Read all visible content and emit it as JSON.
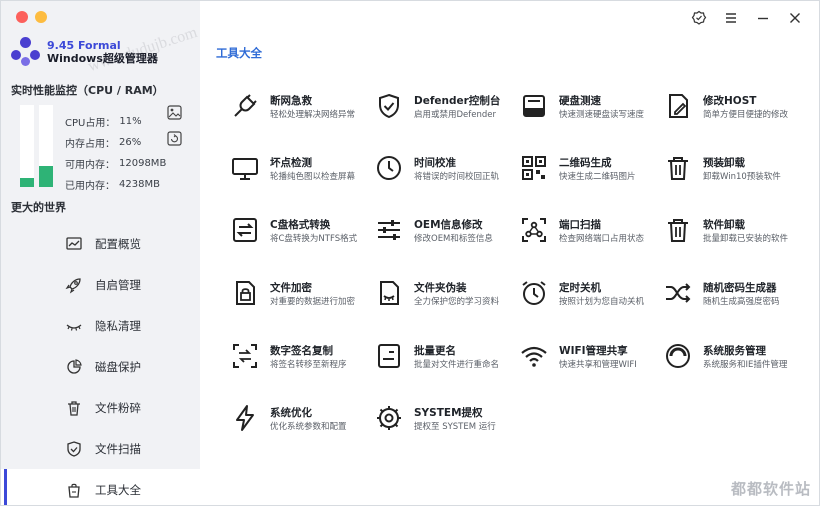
{
  "app": {
    "version": "9.45 Formal",
    "title": "Windows超级管理器"
  },
  "monitor": {
    "title": "实时性能监控（CPU / RAM）",
    "cpu_label": "CPU占用：",
    "cpu_value": "11%",
    "mem_label": "内存占用：",
    "mem_value": "26%",
    "avail_label": "可用内存：",
    "avail_value": "12098MB",
    "used_label": "已用内存：",
    "used_value": "4238MB",
    "cpu_fraction": 0.11,
    "mem_fraction": 0.26
  },
  "sidebar": {
    "subtitle": "更大的世界",
    "items": [
      {
        "label": "配置概览",
        "icon": "chart-icon"
      },
      {
        "label": "自启管理",
        "icon": "rocket-icon"
      },
      {
        "label": "隐私清理",
        "icon": "eye-closed-icon"
      },
      {
        "label": "磁盘保护",
        "icon": "pie-icon"
      },
      {
        "label": "文件粉碎",
        "icon": "trash-icon"
      },
      {
        "label": "文件扫描",
        "icon": "shield-check-icon"
      },
      {
        "label": "工具大全",
        "icon": "bag-icon"
      }
    ],
    "active_index": 6
  },
  "main": {
    "section_title": "工具大全"
  },
  "tools": [
    {
      "name": "断网急救",
      "desc": "轻松处理解决网络异常",
      "icon": "plug-icon"
    },
    {
      "name": "Defender控制台",
      "desc": "启用或禁用Defender",
      "icon": "shield-check-icon"
    },
    {
      "name": "硬盘测速",
      "desc": "快速测速硬盘读写速度",
      "icon": "disk-icon"
    },
    {
      "name": "修改HOST",
      "desc": "简单方便目便捷的修改",
      "icon": "document-edit-icon"
    },
    {
      "name": "坏点检测",
      "desc": "轮播纯色图以检查屏幕",
      "icon": "monitor-icon"
    },
    {
      "name": "时间校准",
      "desc": "将错误的时间校回正轨",
      "icon": "clock-icon"
    },
    {
      "name": "二维码生成",
      "desc": "快速生成二维码图片",
      "icon": "qrcode-icon"
    },
    {
      "name": "预装卸载",
      "desc": "卸载Win10预装软件",
      "icon": "trash-icon"
    },
    {
      "name": "C盘格式转换",
      "desc": "将C盘转换为NTFS格式",
      "icon": "swap-icon"
    },
    {
      "name": "OEM信息修改",
      "desc": "修改OEM和标签信息",
      "icon": "sliders-icon"
    },
    {
      "name": "端口扫描",
      "desc": "检查网络端口占用状态",
      "icon": "network-scan-icon"
    },
    {
      "name": "软件卸载",
      "desc": "批量卸载已安装的软件",
      "icon": "trash-icon"
    },
    {
      "name": "文件加密",
      "desc": "对重要的数据进行加密",
      "icon": "file-lock-icon"
    },
    {
      "name": "文件夹伪装",
      "desc": "全力保护您的学习资料",
      "icon": "file-mask-icon"
    },
    {
      "name": "定时关机",
      "desc": "按照计划为您自动关机",
      "icon": "alarm-clock-icon"
    },
    {
      "name": "随机密码生成器",
      "desc": "随机生成高强度密码",
      "icon": "shuffle-icon"
    },
    {
      "name": "数字签名复制",
      "desc": "将签名转移至新程序",
      "icon": "copy-sign-icon"
    },
    {
      "name": "批量更名",
      "desc": "批量对文件进行重命名",
      "icon": "rename-icon"
    },
    {
      "name": "WIFI管理共享",
      "desc": "快速共享和管理WIFI",
      "icon": "wifi-icon"
    },
    {
      "name": "系统服务管理",
      "desc": "系统服务和IE插件管理",
      "icon": "service-ring-icon"
    },
    {
      "name": "系统优化",
      "desc": "优化系统参数和配置",
      "icon": "lightning-icon"
    },
    {
      "name": "SYSTEM提权",
      "desc": "提权至 SYSTEM 运行",
      "icon": "gear-cluster-icon"
    }
  ],
  "watermark": "都都软件站",
  "watermark_diag": "www.dudujb.com",
  "colors": {
    "accent": "#3c49d8",
    "section_title": "#2f6bd6",
    "bar_fill": "#2eb376",
    "sidebar_bg": "#f1f2f5"
  }
}
